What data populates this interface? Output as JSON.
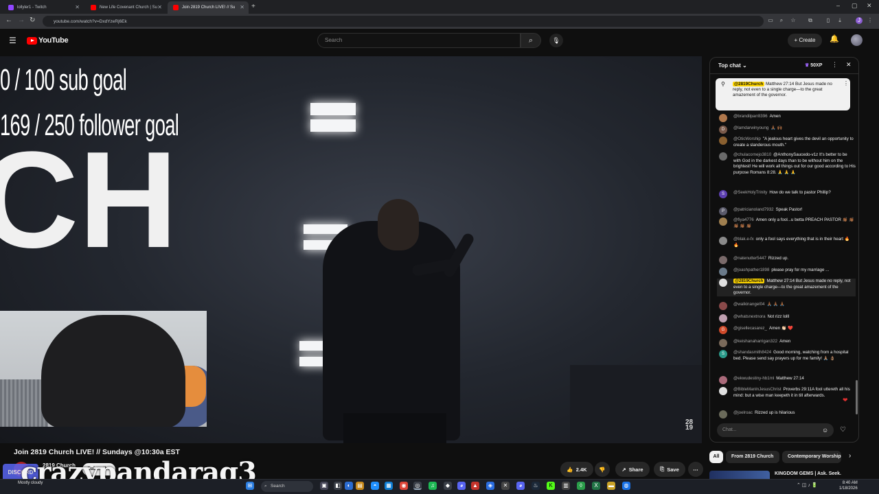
{
  "browser": {
    "tabs": [
      {
        "label": "lollyler1 - Twitch",
        "favicon_color": "#9146ff"
      },
      {
        "label": "New Life Covenant Church | Su",
        "favicon_color": "#ff0000"
      },
      {
        "label": "Join 2819 Church LIVE! // Su",
        "favicon_color": "#ff0000"
      }
    ],
    "new_tab": "+",
    "url": "youtube.com/watch?v=DxdYzeRj6Ek"
  },
  "youtube": {
    "logo_text": "YouTube",
    "search_placeholder": "Search",
    "create_label": "Create"
  },
  "overlay": {
    "sub_goal": "0 / 100 sub goal",
    "follower_goal": "169 / 250 follower goal",
    "streamer_name": "crazypandarag3",
    "discord_label": "DISCORD",
    "video_watermark_top": "28",
    "video_watermark_bottom": "19",
    "stage_letters_top": "CH",
    "stage_letters_bottom": "H"
  },
  "video": {
    "title": "Join 2819 Church LIVE! // Sundays @10:30a EST",
    "channel": "2819 Church",
    "subscribe_label": "Subscribe",
    "likes": "2.4K",
    "share_label": "Share",
    "save_label": "Save"
  },
  "chat": {
    "header": "Top chat",
    "xp": "50XP",
    "pinned": {
      "author": "@2819Church",
      "text": "Matthew 27:14 But Jesus made no reply, not even to a single charge—to the great amazement of the governor."
    },
    "messages": [
      {
        "author": "@brandilparr8396",
        "text": "Amen",
        "color": "#b0784c",
        "initial": ""
      },
      {
        "author": "@lamdarwinyoung",
        "text": "🙏🏾 🙌🏾",
        "color": "#7a5a4a",
        "initial": "D"
      },
      {
        "author": "@OticWorship",
        "text": "\"A jealous heart gives the devil an opportunity to create a slanderous mouth.\"",
        "color": "#8a6030",
        "initial": ""
      },
      {
        "author": "@chulacornejo3810",
        "text": "@AnthonySaucedo-v1z It's better to be with God in the darkest days than to be without him on the brightest! He will work all things out for our good according to His purpose Romans 8:28. 🙏 🙏 🙏",
        "color": "#6a6a6a",
        "initial": ""
      },
      {
        "author": "@SeekHolyTrinity",
        "text": "How do we talk to pastor Phillip?",
        "color": "#5c3fb0",
        "initial": "S"
      },
      {
        "author": "@patricianoland7932",
        "text": "Speak Pastor!",
        "color": "#5a5a6a",
        "initial": "P"
      },
      {
        "author": "@fiya4776",
        "text": "Amen only a fool...u betta PREACH PASTOR 👏🏾 👏🏾 👏🏾 👏🏾 👏🏾",
        "color": "#a08050",
        "initial": ""
      },
      {
        "author": "@blak.e-fx",
        "text": "only a fool says everything that is in their heart 🔥 🔥",
        "color": "#8a8a8a",
        "initial": ""
      },
      {
        "author": "@natenutter5447",
        "text": "Rizzed up.",
        "color": "#7a6a6a",
        "initial": ""
      },
      {
        "author": "@joashpather1898",
        "text": "please pray for my marriage ...",
        "color": "#6a7a8a",
        "initial": ""
      },
      {
        "author": "@2819Church",
        "text": "Matthew 27:14 But Jesus made no reply, not even to a single charge—to the great amazement of the governor.",
        "color": "#e0e0e0",
        "initial": "",
        "owner": true
      },
      {
        "author": "@walkinangel04",
        "text": "🙏🏾 🙏🏾 🙏🏾",
        "color": "#8a4a4a",
        "initial": ""
      },
      {
        "author": "@whatsnextnora",
        "text": "Not rizz lolll",
        "color": "#c0a0b0",
        "initial": ""
      },
      {
        "author": "@gisellecasarez_",
        "text": "Amen 👏🏻 ❤️",
        "color": "#d04a2a",
        "initial": "G"
      },
      {
        "author": "@keishanaharrigan322",
        "text": "Amen",
        "color": "#7a6a5a",
        "initial": ""
      },
      {
        "author": "@shandasmith8424",
        "text": "Good morning, watching from a hospital bed. Please send say prayers up for me family! 🙏🏽 👌🏽",
        "color": "#2a9a8a",
        "initial": "S"
      },
      {
        "author": "@ekwudestiny-hb1ml",
        "text": "Matthew 27:14",
        "color": "#aa6a7a",
        "initial": ""
      },
      {
        "author": "@BibleManInJesusChrist",
        "text": "Proverbs 29:11A fool uttereth all his mind: but a wise man keepeth it in till afterwards.",
        "color": "#e0e0e0",
        "initial": ""
      },
      {
        "author": "@joelroac",
        "text": "Rizzed up is hilarious",
        "color": "#6a6a5a",
        "initial": ""
      }
    ],
    "input_placeholder": "Chat..."
  },
  "recommendations": {
    "chips": [
      "All",
      "From 2819 Church",
      "Contemporary Worship"
    ],
    "first_title": "KINGDOM GEMS | Ask. Seek."
  },
  "taskbar": {
    "weather_line1": "Mostly cloudy",
    "search_label": "Search",
    "time": "8:40 AM",
    "date": "1/18/2026"
  }
}
